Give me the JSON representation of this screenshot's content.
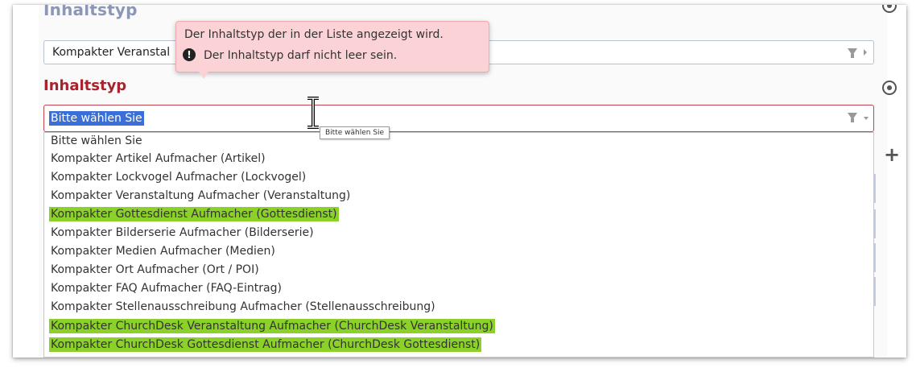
{
  "upper_field": {
    "title": "Inhaltstyp",
    "value": "Kompakter Veranstal"
  },
  "tooltip": {
    "line1": "Der Inhaltstyp der in der Liste angezeigt wird.",
    "line2": "Der Inhaltstyp darf nicht leer sein.",
    "icon": "exclamation-circle-icon",
    "error_glyph": "!"
  },
  "field": {
    "label": "Inhaltstyp",
    "selected": "Bitte wählen Sie",
    "hover_tip": "Bitte wählen Sie"
  },
  "options": [
    {
      "label": "Bitte wählen Sie",
      "highlighted": false
    },
    {
      "label": "Kompakter Artikel Aufmacher (Artikel)",
      "highlighted": false
    },
    {
      "label": "Kompakter Lockvogel Aufmacher (Lockvogel)",
      "highlighted": false
    },
    {
      "label": "Kompakter Veranstaltung Aufmacher (Veranstaltung)",
      "highlighted": false
    },
    {
      "label": "Kompakter Gottesdienst Aufmacher (Gottesdienst)",
      "highlighted": true
    },
    {
      "label": "Kompakter Bilderserie Aufmacher (Bilderserie)",
      "highlighted": false
    },
    {
      "label": "Kompakter Medien Aufmacher (Medien)",
      "highlighted": false
    },
    {
      "label": "Kompakter Ort Aufmacher (Ort / POI)",
      "highlighted": false
    },
    {
      "label": "Kompakter FAQ Aufmacher (FAQ-Eintrag)",
      "highlighted": false
    },
    {
      "label": "Kompakter Stellenausschreibung Aufmacher (Stellenausschreibung)",
      "highlighted": false
    },
    {
      "label": "Kompakter ChurchDesk Veranstaltung Aufmacher (ChurchDesk Veranstaltung)",
      "highlighted": true
    },
    {
      "label": "Kompakter ChurchDesk Gottesdienst Aufmacher (ChurchDesk Gottesdienst)",
      "highlighted": true
    }
  ],
  "side_controls": {
    "plus_glyph": "+",
    "plus_icon": "plus-icon",
    "radio_icon": "radio-target-icon"
  },
  "colors": {
    "error_red": "#a8232d",
    "highlight_green": "#8cd12a",
    "selection_blue": "#3a6fd8",
    "tooltip_bg": "#fbd2d5"
  }
}
